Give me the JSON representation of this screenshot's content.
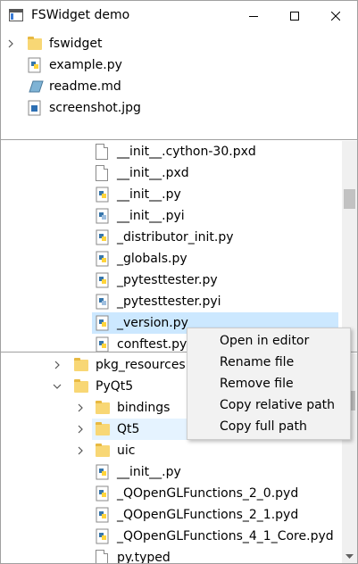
{
  "window": {
    "title": "FSWidget demo"
  },
  "pane1": {
    "items": [
      {
        "label": "fswidget",
        "icon": "folder-icon"
      },
      {
        "label": "example.py",
        "icon": "python-file-icon"
      },
      {
        "label": "readme.md",
        "icon": "markdown-file-icon"
      },
      {
        "label": "screenshot.jpg",
        "icon": "image-file-icon"
      }
    ]
  },
  "pane2": {
    "items": [
      {
        "label": "__init__.cython-30.pxd",
        "icon": "file-icon"
      },
      {
        "label": "__init__.pxd",
        "icon": "file-icon"
      },
      {
        "label": "__init__.py",
        "icon": "python-file-icon"
      },
      {
        "label": "__init__.pyi",
        "icon": "python-stub-file-icon"
      },
      {
        "label": "_distributor_init.py",
        "icon": "python-file-icon"
      },
      {
        "label": "_globals.py",
        "icon": "python-file-icon"
      },
      {
        "label": "_pytesttester.py",
        "icon": "python-file-icon"
      },
      {
        "label": "_pytesttester.pyi",
        "icon": "python-stub-file-icon"
      },
      {
        "label": "_version.py",
        "icon": "python-file-icon"
      },
      {
        "label": "conftest.py",
        "icon": "python-file-icon"
      }
    ]
  },
  "pane3": {
    "items": [
      {
        "label": "pkg_resources",
        "icon": "folder-icon"
      },
      {
        "label": "PyQt5",
        "icon": "folder-icon"
      },
      {
        "label": "bindings",
        "icon": "folder-icon"
      },
      {
        "label": "Qt5",
        "icon": "folder-icon"
      },
      {
        "label": "uic",
        "icon": "folder-icon"
      },
      {
        "label": "__init__.py",
        "icon": "python-file-icon"
      },
      {
        "label": "_QOpenGLFunctions_2_0.pyd",
        "icon": "python-file-icon"
      },
      {
        "label": "_QOpenGLFunctions_2_1.pyd",
        "icon": "python-file-icon"
      },
      {
        "label": "_QOpenGLFunctions_4_1_Core.pyd",
        "icon": "python-file-icon"
      },
      {
        "label": "py.typed",
        "icon": "file-icon"
      }
    ]
  },
  "context_menu": {
    "items": [
      {
        "label": "Open in editor"
      },
      {
        "label": "Rename file"
      },
      {
        "label": "Remove file"
      },
      {
        "label": "Copy relative path"
      },
      {
        "label": "Copy full path"
      }
    ]
  },
  "colors": {
    "selection": "#cce8ff",
    "hover": "#e5f3ff",
    "menu_bg": "#f2f2f2"
  }
}
